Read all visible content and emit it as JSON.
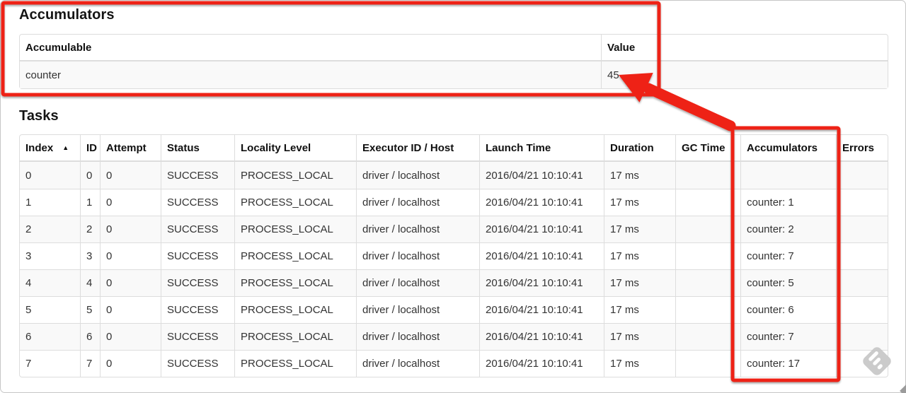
{
  "accumulators_section": {
    "title": "Accumulators",
    "headers": [
      "Accumulable",
      "Value"
    ],
    "rows": [
      [
        "counter",
        "45"
      ]
    ]
  },
  "tasks_section": {
    "title": "Tasks",
    "headers": [
      "Index",
      "ID",
      "Attempt",
      "Status",
      "Locality Level",
      "Executor ID / Host",
      "Launch Time",
      "Duration",
      "GC Time",
      "Accumulators",
      "Errors"
    ],
    "sorted_column": "Index",
    "sort_indicator": "▲",
    "rows": [
      [
        "0",
        "0",
        "0",
        "SUCCESS",
        "PROCESS_LOCAL",
        "driver / localhost",
        "2016/04/21 10:10:41",
        "17 ms",
        "",
        "",
        ""
      ],
      [
        "1",
        "1",
        "0",
        "SUCCESS",
        "PROCESS_LOCAL",
        "driver / localhost",
        "2016/04/21 10:10:41",
        "17 ms",
        "",
        "counter: 1",
        ""
      ],
      [
        "2",
        "2",
        "0",
        "SUCCESS",
        "PROCESS_LOCAL",
        "driver / localhost",
        "2016/04/21 10:10:41",
        "17 ms",
        "",
        "counter: 2",
        ""
      ],
      [
        "3",
        "3",
        "0",
        "SUCCESS",
        "PROCESS_LOCAL",
        "driver / localhost",
        "2016/04/21 10:10:41",
        "17 ms",
        "",
        "counter: 7",
        ""
      ],
      [
        "4",
        "4",
        "0",
        "SUCCESS",
        "PROCESS_LOCAL",
        "driver / localhost",
        "2016/04/21 10:10:41",
        "17 ms",
        "",
        "counter: 5",
        ""
      ],
      [
        "5",
        "5",
        "0",
        "SUCCESS",
        "PROCESS_LOCAL",
        "driver / localhost",
        "2016/04/21 10:10:41",
        "17 ms",
        "",
        "counter: 6",
        ""
      ],
      [
        "6",
        "6",
        "0",
        "SUCCESS",
        "PROCESS_LOCAL",
        "driver / localhost",
        "2016/04/21 10:10:41",
        "17 ms",
        "",
        "counter: 7",
        ""
      ],
      [
        "7",
        "7",
        "0",
        "SUCCESS",
        "PROCESS_LOCAL",
        "driver / localhost",
        "2016/04/21 10:10:41",
        "17 ms",
        "",
        "counter: 17",
        ""
      ]
    ]
  },
  "annotations": {
    "color": "#ee2213",
    "arrow_points_to_value": "45",
    "boxed_regions": [
      "accumulators summary table",
      "tasks accumulators column"
    ]
  },
  "watermark": {
    "icon": "annotation-tool-logo",
    "color": "#c9c9c9"
  }
}
